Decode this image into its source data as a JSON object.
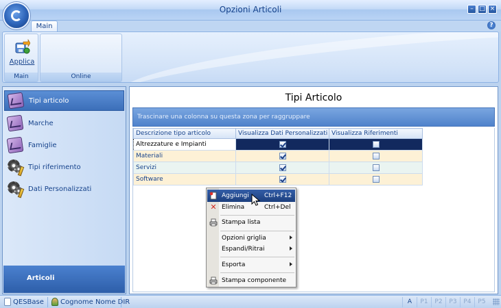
{
  "window": {
    "title": "Opzioni Articoli"
  },
  "ribbon": {
    "tabs": [
      {
        "label": "Main"
      }
    ],
    "groups": [
      {
        "label": "Main",
        "buttons": [
          {
            "label": "Applica"
          }
        ]
      },
      {
        "label": "Online"
      }
    ]
  },
  "nav": {
    "items": [
      {
        "label": "Tipi articolo",
        "icon": "chart-icon",
        "selected": true
      },
      {
        "label": "Marche",
        "icon": "chart-icon"
      },
      {
        "label": "Famiglie",
        "icon": "chart-icon"
      },
      {
        "label": "Tipi riferimento",
        "icon": "gear-pencil-icon"
      },
      {
        "label": "Dati Personalizzati",
        "icon": "gear-pencil-icon"
      }
    ],
    "footer": "Articoli"
  },
  "content": {
    "title": "Tipi Articolo",
    "group_hint": "Trascinare una colonna su questa zona per raggruppare",
    "columns": [
      "Descrizione tipo articolo",
      "Visualizza Dati Personalizzati",
      "Visualizza Riferimenti"
    ],
    "rows": [
      {
        "desc": "Altrezzature e Impianti",
        "dati": true,
        "rif": false
      },
      {
        "desc": "Materiali",
        "dati": true,
        "rif": false
      },
      {
        "desc": "Servizi",
        "dati": true,
        "rif": false
      },
      {
        "desc": "Software",
        "dati": true,
        "rif": false
      }
    ]
  },
  "context_menu": {
    "items": [
      {
        "label": "Aggiungi",
        "shortcut": "Ctrl+F12",
        "icon": "new-document-icon"
      },
      {
        "label": "Elimina",
        "shortcut": "Ctrl+Del",
        "icon": "delete-x-icon"
      },
      {
        "label": "Stampa lista",
        "icon": "printer-icon"
      },
      {
        "label": "Opzioni griglia",
        "submenu": true
      },
      {
        "label": "Espandi/Ritrai",
        "submenu": true
      },
      {
        "label": "Esporta",
        "submenu": true
      },
      {
        "label": "Stampa componente",
        "icon": "printer-icon"
      }
    ]
  },
  "status": {
    "database": "QESBase",
    "user": "Cognome Nome DIR",
    "panes": [
      "A",
      "P1",
      "P2",
      "P3",
      "P4",
      "P5"
    ]
  },
  "colors": {
    "accent": "#15428b",
    "selection": "#12295e",
    "row_even": "#eaf4f1",
    "row_odd": "#fdf1d6"
  }
}
